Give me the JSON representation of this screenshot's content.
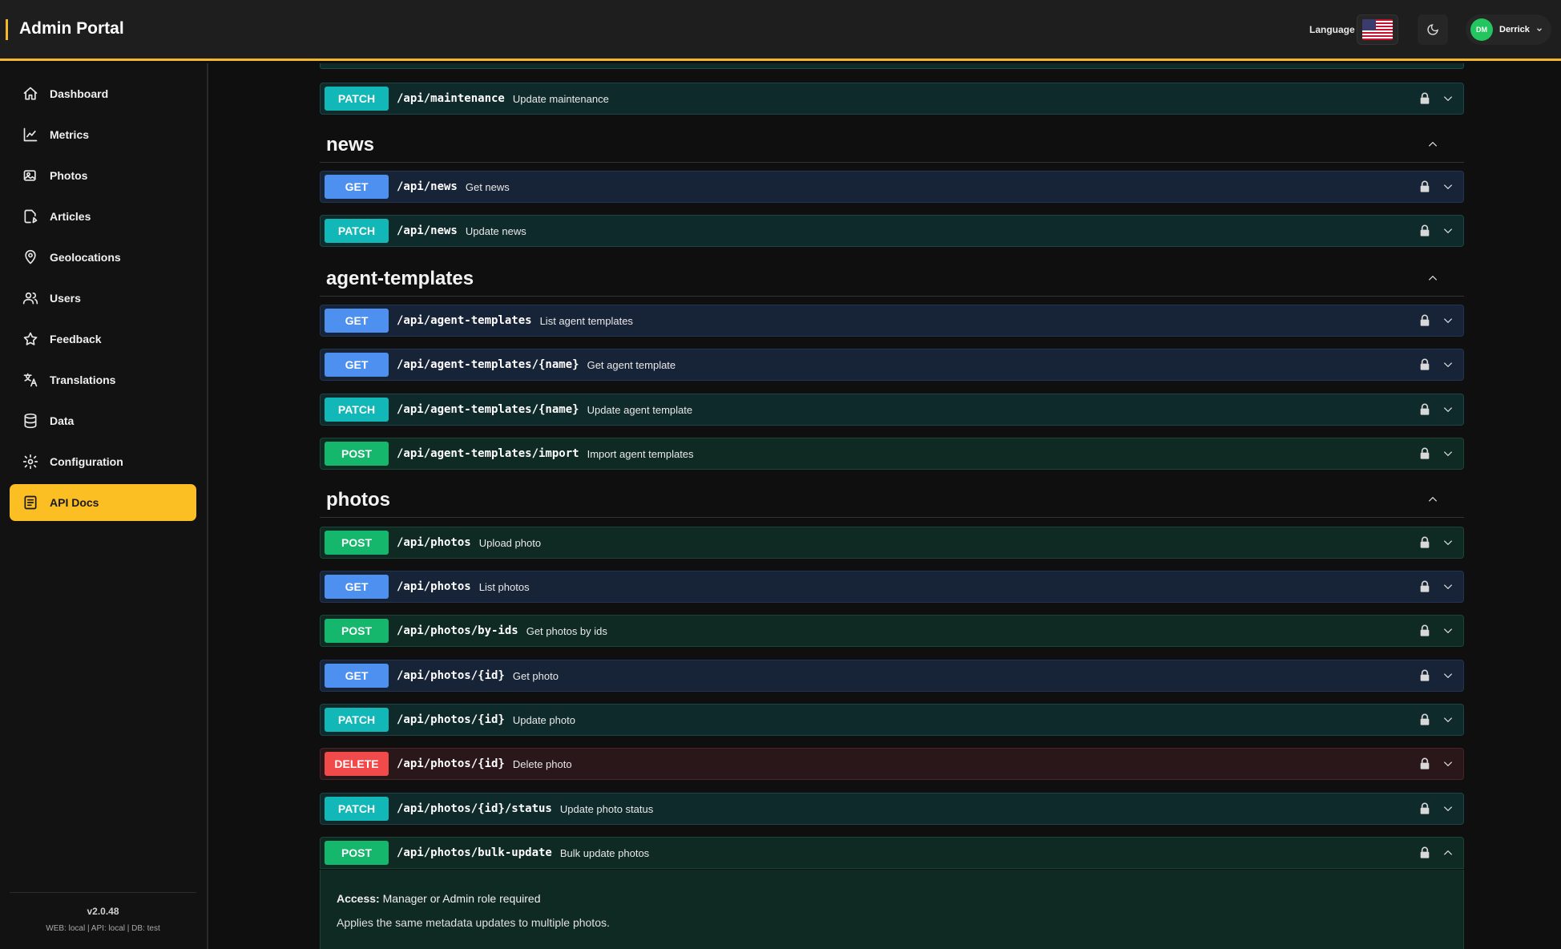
{
  "app": {
    "title": "Admin Portal"
  },
  "header": {
    "language_label": "Language",
    "flag_icon": "us-flag-icon",
    "theme_icon": "moon-icon",
    "user": {
      "initials": "DM",
      "name": "Derrick"
    }
  },
  "sidebar": {
    "items": [
      {
        "label": "Dashboard",
        "icon": "home-icon"
      },
      {
        "label": "Metrics",
        "icon": "chart-icon"
      },
      {
        "label": "Photos",
        "icon": "photos-icon"
      },
      {
        "label": "Articles",
        "icon": "article-icon"
      },
      {
        "label": "Geolocations",
        "icon": "map-pin-icon"
      },
      {
        "label": "Users",
        "icon": "users-icon"
      },
      {
        "label": "Feedback",
        "icon": "star-icon"
      },
      {
        "label": "Translations",
        "icon": "translate-icon"
      },
      {
        "label": "Data",
        "icon": "database-icon"
      },
      {
        "label": "Configuration",
        "icon": "gear-icon"
      },
      {
        "label": "API Docs",
        "icon": "docs-icon",
        "active": true
      }
    ],
    "version": "v2.0.48",
    "env": "WEB: local  |  API: local  |  DB: test"
  },
  "top_ops": [
    {
      "method": "PATCH",
      "path": "/api/maintenance",
      "summary": "Update maintenance"
    }
  ],
  "sections": [
    {
      "name": "news",
      "ops": [
        {
          "method": "GET",
          "path": "/api/news",
          "summary": "Get news"
        },
        {
          "method": "PATCH",
          "path": "/api/news",
          "summary": "Update news"
        }
      ]
    },
    {
      "name": "agent-templates",
      "ops": [
        {
          "method": "GET",
          "path": "/api/agent-templates",
          "summary": "List agent templates"
        },
        {
          "method": "GET",
          "path": "/api/agent-templates/{name}",
          "summary": "Get agent template"
        },
        {
          "method": "PATCH",
          "path": "/api/agent-templates/{name}",
          "summary": "Update agent template"
        },
        {
          "method": "POST",
          "path": "/api/agent-templates/import",
          "summary": "Import agent templates"
        }
      ]
    },
    {
      "name": "photos",
      "ops": [
        {
          "method": "POST",
          "path": "/api/photos",
          "summary": "Upload photo"
        },
        {
          "method": "GET",
          "path": "/api/photos",
          "summary": "List photos"
        },
        {
          "method": "POST",
          "path": "/api/photos/by-ids",
          "summary": "Get photos by ids"
        },
        {
          "method": "GET",
          "path": "/api/photos/{id}",
          "summary": "Get photo"
        },
        {
          "method": "PATCH",
          "path": "/api/photos/{id}",
          "summary": "Update photo"
        },
        {
          "method": "DELETE",
          "path": "/api/photos/{id}",
          "summary": "Delete photo"
        },
        {
          "method": "PATCH",
          "path": "/api/photos/{id}/status",
          "summary": "Update photo status"
        },
        {
          "method": "POST",
          "path": "/api/photos/bulk-update",
          "summary": "Bulk update photos",
          "expanded": true
        }
      ]
    }
  ],
  "expanded_detail": {
    "access_label": "Access:",
    "access_value": "Manager or Admin role required",
    "description": "Applies the same metadata updates to multiple photos."
  }
}
